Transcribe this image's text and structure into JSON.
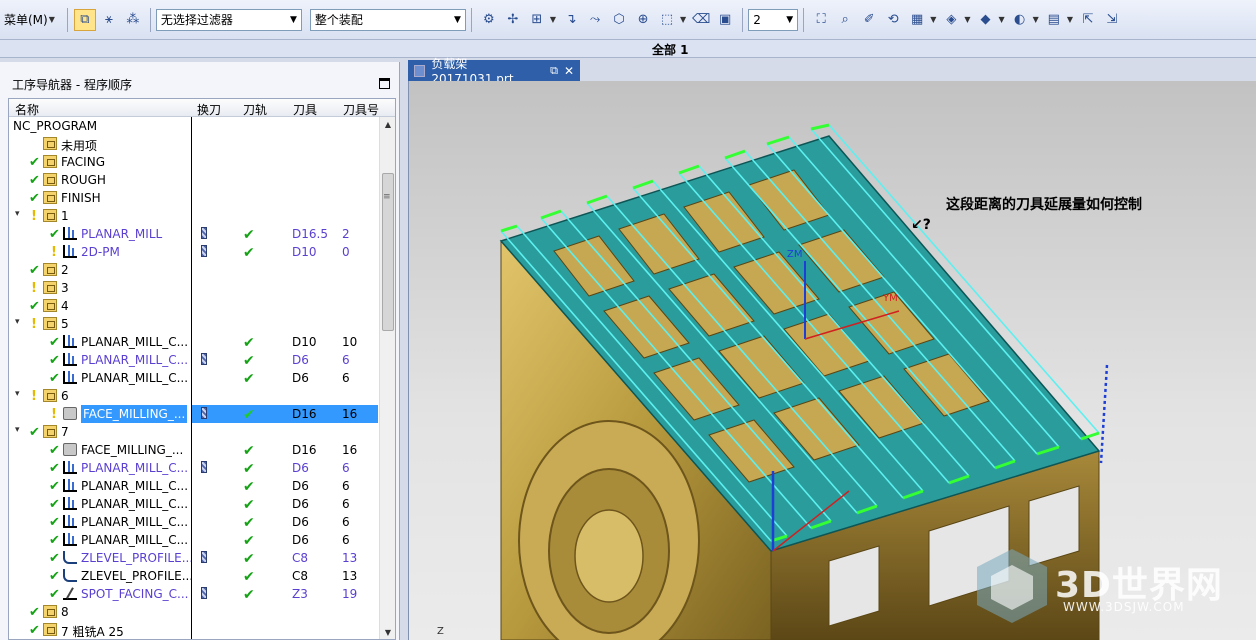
{
  "toolbar": {
    "menu_label": "菜单(M)",
    "filter_value": "无选择过滤器",
    "assembly_value": "整个装配",
    "layer_value": "2"
  },
  "subheader": {
    "label": "全部 1"
  },
  "navigator": {
    "title": "工序导航器 - 程序顺序",
    "columns": [
      "名称",
      "换刀",
      "刀轨",
      "刀具",
      "刀具号"
    ],
    "rows": [
      {
        "name": "NC_PROGRAM",
        "level": 0,
        "icon": "none",
        "status": "none",
        "expand": false
      },
      {
        "name": "未用项",
        "level": 1,
        "icon": "folder",
        "status": "none"
      },
      {
        "name": "FACING",
        "level": 1,
        "icon": "folder",
        "status": "ok"
      },
      {
        "name": "ROUGH",
        "level": 1,
        "icon": "folder",
        "status": "ok"
      },
      {
        "name": "FINISH",
        "level": 1,
        "icon": "folder",
        "status": "ok"
      },
      {
        "name": "1",
        "level": 1,
        "icon": "folder",
        "status": "warn",
        "expand": true
      },
      {
        "name": "PLANAR_MILL",
        "level": 2,
        "icon": "op",
        "status": "ok",
        "blue": true,
        "toolchange": true,
        "path": true,
        "tool": "D16.5",
        "tool_no": "2"
      },
      {
        "name": "2D-PM",
        "level": 2,
        "icon": "op",
        "status": "warn",
        "blue": true,
        "toolchange": true,
        "path": true,
        "tool": "D10",
        "tool_no": "0"
      },
      {
        "name": "2",
        "level": 1,
        "icon": "folder",
        "status": "ok"
      },
      {
        "name": "3",
        "level": 1,
        "icon": "folder",
        "status": "warn"
      },
      {
        "name": "4",
        "level": 1,
        "icon": "folder",
        "status": "ok"
      },
      {
        "name": "5",
        "level": 1,
        "icon": "folder",
        "status": "warn",
        "expand": true
      },
      {
        "name": "PLANAR_MILL_C...",
        "level": 2,
        "icon": "op",
        "status": "ok",
        "path": true,
        "tool": "D10",
        "tool_no": "10"
      },
      {
        "name": "PLANAR_MILL_C...",
        "level": 2,
        "icon": "op",
        "status": "ok",
        "blue": true,
        "toolchange": true,
        "path": true,
        "tool": "D6",
        "tool_no": "6"
      },
      {
        "name": "PLANAR_MILL_C...",
        "level": 2,
        "icon": "op",
        "status": "ok",
        "path": true,
        "tool": "D6",
        "tool_no": "6"
      },
      {
        "name": "6",
        "level": 1,
        "icon": "folder",
        "status": "warn",
        "expand": true
      },
      {
        "name": "FACE_MILLING_...",
        "level": 2,
        "icon": "fm",
        "status": "warn",
        "toolchange": true,
        "path": true,
        "tool": "D16",
        "tool_no": "16",
        "selected": true
      },
      {
        "name": "7",
        "level": 1,
        "icon": "folder",
        "status": "ok",
        "expand": true
      },
      {
        "name": "FACE_MILLING_...",
        "level": 2,
        "icon": "fm",
        "status": "ok",
        "path": true,
        "tool": "D16",
        "tool_no": "16"
      },
      {
        "name": "PLANAR_MILL_C...",
        "level": 2,
        "icon": "op",
        "status": "ok",
        "blue": true,
        "toolchange": true,
        "path": true,
        "tool": "D6",
        "tool_no": "6"
      },
      {
        "name": "PLANAR_MILL_C...",
        "level": 2,
        "icon": "op",
        "status": "ok",
        "path": true,
        "tool": "D6",
        "tool_no": "6"
      },
      {
        "name": "PLANAR_MILL_C...",
        "level": 2,
        "icon": "op",
        "status": "ok",
        "path": true,
        "tool": "D6",
        "tool_no": "6"
      },
      {
        "name": "PLANAR_MILL_C...",
        "level": 2,
        "icon": "op",
        "status": "ok",
        "path": true,
        "tool": "D6",
        "tool_no": "6"
      },
      {
        "name": "PLANAR_MILL_C...",
        "level": 2,
        "icon": "op",
        "status": "ok",
        "path": true,
        "tool": "D6",
        "tool_no": "6"
      },
      {
        "name": "ZLEVEL_PROFILE...",
        "level": 2,
        "icon": "zl",
        "status": "ok",
        "blue": true,
        "toolchange": true,
        "path": true,
        "tool": "C8",
        "tool_no": "13"
      },
      {
        "name": "ZLEVEL_PROFILE...",
        "level": 2,
        "icon": "zl",
        "status": "ok",
        "path": true,
        "tool": "C8",
        "tool_no": "13"
      },
      {
        "name": "SPOT_FACING_C...",
        "level": 2,
        "icon": "sf",
        "status": "ok",
        "blue": true,
        "toolchange": true,
        "path": true,
        "tool": "Z3",
        "tool_no": "19"
      },
      {
        "name": "8",
        "level": 1,
        "icon": "folder",
        "status": "ok"
      },
      {
        "name": "7 粗铣A 25",
        "level": 1,
        "icon": "folder",
        "status": "ok"
      }
    ]
  },
  "viewport": {
    "tab_title": "负载架20171031.prt",
    "annotation": "这段距离的刀具延展量如何控制",
    "axis_z": "ZM",
    "axis_y": "YM",
    "axis_z2": "Z",
    "watermark_text": "3D世界网",
    "watermark_url": "WWW.3DSJW.COM"
  },
  "colors": {
    "selection": "#3399ff",
    "check_green": "#14a314",
    "warn_yellow": "#e6b800",
    "part_gold": "#b89a3e",
    "toolpath_teal": "#2a9c9c",
    "toolpath_line": "#5cf0f0",
    "tab_blue": "#2e5fa8"
  }
}
